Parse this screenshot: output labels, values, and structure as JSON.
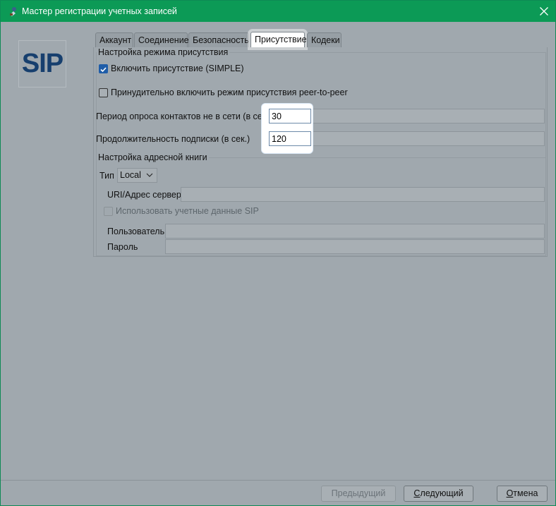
{
  "window": {
    "title": "Мастер регистрации учетных записей",
    "icons": {
      "app": "sip-phone-icon",
      "close": "close-icon"
    }
  },
  "logo": {
    "text": "SIP"
  },
  "tabs": [
    {
      "label": "Аккаунт",
      "active": false
    },
    {
      "label": "Соединение",
      "active": false
    },
    {
      "label": "Безопасность",
      "active": false
    },
    {
      "label": "Присутствие",
      "active": true
    },
    {
      "label": "Кодеки",
      "active": false
    }
  ],
  "presence": {
    "group_title": "Настройка режима присутствия",
    "enable_label": "Включить присутствие (SIMPLE)",
    "enable_checked": true,
    "p2p_label": "Принудительно включить режим присутствия peer-to-peer",
    "p2p_checked": false,
    "poll_label": "Период опроса контактов не в сети (в сек.)",
    "poll_value": "30",
    "sub_label": "Продолжительность подписки (в сек.)",
    "sub_value": "120"
  },
  "addressbook": {
    "group_title": "Настройка адресной книги",
    "type_label": "Тип",
    "type_value": "Local",
    "uri_label": "URI/Адрес сервера",
    "uri_value": "",
    "use_sip_label": "Использовать учетные данные SIP",
    "use_sip_checked": false,
    "user_label": "Пользователь",
    "user_value": "",
    "password_label": "Пароль",
    "password_value": ""
  },
  "buttons": {
    "prev": "Предыдущий",
    "next_first": "С",
    "next_rest": "ледующий",
    "cancel_first": "О",
    "cancel_rest": "тмена"
  },
  "colors": {
    "titlebar": "#0c9a56",
    "dialog_bg": "#a0a8ae",
    "logo_text": "#173f6e",
    "checkbox_checked": "#1f5da8"
  }
}
